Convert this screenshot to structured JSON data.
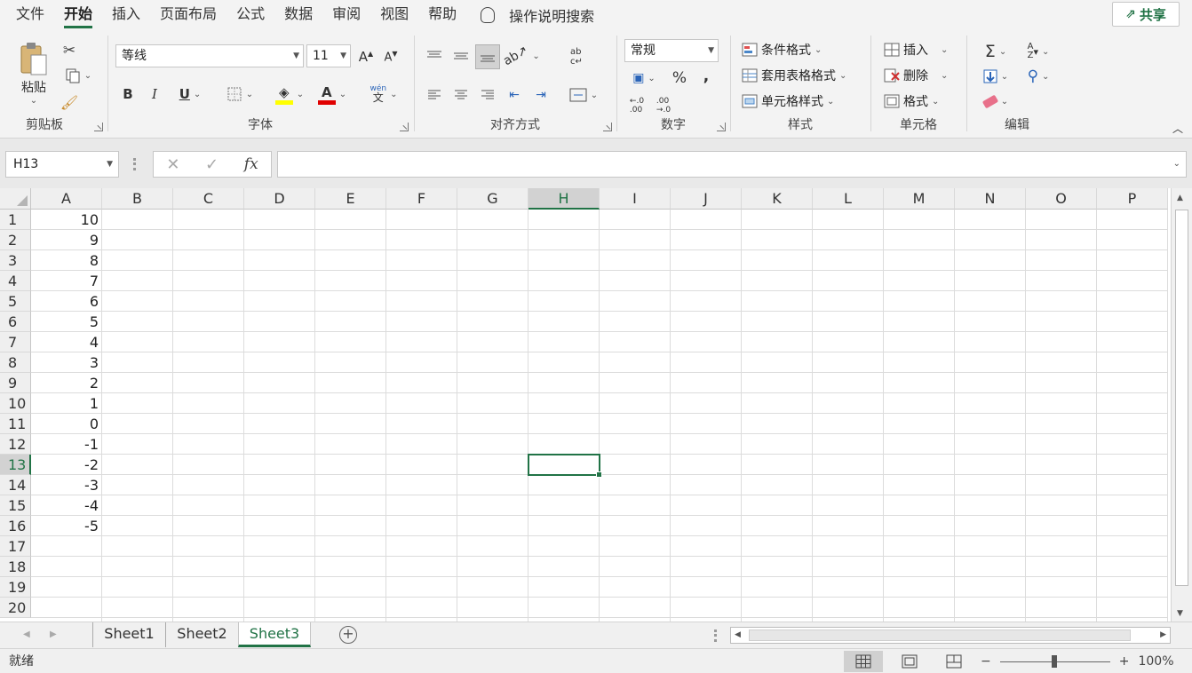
{
  "menu": {
    "tabs": [
      "文件",
      "开始",
      "插入",
      "页面布局",
      "公式",
      "数据",
      "审阅",
      "视图",
      "帮助"
    ],
    "active_tab": "开始",
    "tell_me": "操作说明搜索",
    "share": "共享"
  },
  "ribbon": {
    "clipboard": {
      "paste": "粘贴",
      "label": "剪贴板"
    },
    "font": {
      "name": "等线",
      "size": "11",
      "label": "字体"
    },
    "alignment": {
      "label": "对齐方式"
    },
    "number": {
      "format": "常规",
      "percent": "%",
      "comma": ",",
      "label": "数字"
    },
    "styles": {
      "conditional": "条件格式",
      "table": "套用表格格式",
      "cell": "单元格样式",
      "label": "样式"
    },
    "cells": {
      "insert": "插入",
      "delete": "删除",
      "format": "格式",
      "label": "单元格"
    },
    "editing": {
      "label": "编辑"
    }
  },
  "formula_bar": {
    "name_box": "H13",
    "formula": ""
  },
  "grid": {
    "columns": [
      "A",
      "B",
      "C",
      "D",
      "E",
      "F",
      "G",
      "H",
      "I",
      "J",
      "K",
      "L",
      "M",
      "N",
      "O",
      "P"
    ],
    "rows": [
      "1",
      "2",
      "3",
      "4",
      "5",
      "6",
      "7",
      "8",
      "9",
      "10",
      "11",
      "12",
      "13",
      "14",
      "15",
      "16",
      "17",
      "18",
      "19",
      "20"
    ],
    "selected_column": "H",
    "selected_row": "13",
    "column_a_values": [
      "10",
      "9",
      "8",
      "7",
      "6",
      "5",
      "4",
      "3",
      "2",
      "1",
      "0",
      "-1",
      "-2",
      "-3",
      "-4",
      "-5"
    ]
  },
  "sheets": {
    "tabs": [
      "Sheet1",
      "Sheet2",
      "Sheet3"
    ],
    "active": "Sheet3"
  },
  "status": {
    "ready": "就绪",
    "zoom": "100%",
    "zoom_minus": "−",
    "zoom_plus": "+"
  },
  "colors": {
    "accent": "#217346",
    "font_color": "#e00000",
    "highlight": "#ffff00"
  }
}
